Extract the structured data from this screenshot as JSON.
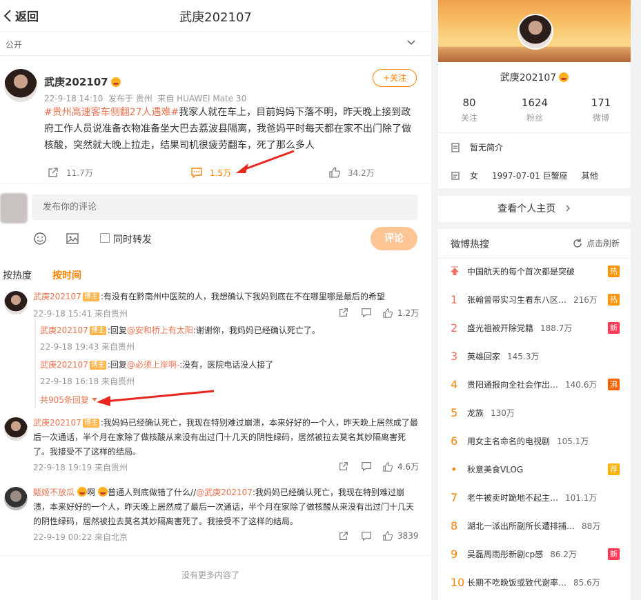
{
  "colors": {
    "brand": "#ff8200",
    "link": "#eb7350",
    "hot": "#ff9406",
    "new": "#ff3852",
    "boil": "#f86400",
    "recommend": "#ffb000"
  },
  "header": {
    "back_label": "返回",
    "title": "武庚202107",
    "visibility": "公开"
  },
  "post": {
    "author": "武庚202107",
    "follow_label": "+关注",
    "time": "22-9-18 14:10",
    "published_from": "发布于 贵州",
    "device": "来自 HUAWEI Mate 30",
    "hashtag": "#贵州高速客车侧翻27人遇难#",
    "text": "我家人就在车上，目前妈妈下落不明，昨天晚上接到政府工作人员说准备衣物准备坐大巴去荔波县隔离，我爸妈平时每天都在家不出门除了做核酸，突然就大晚上拉走，结果司机很疲劳翻车，死了那么多人",
    "reposts": "11.7万",
    "comments": "1.5万",
    "likes": "34.2万"
  },
  "composer": {
    "placeholder": "发布你的评论",
    "repost_label": "同时转发",
    "submit_label": "评论"
  },
  "sort": {
    "hot_label": "按热度",
    "time_label": "按时间"
  },
  "comments": [
    {
      "author": "武庚202107",
      "badge": "博主",
      "text": ":有没有在黔南州中医院的人，我想确认下我妈到底在不在哪里哪是最后的希望",
      "meta": "22-9-18 15:41 来自贵州",
      "likes": "1.2万",
      "replies": [
        {
          "author": "武庚202107",
          "badge": "博主",
          "prefix": ":回复",
          "mention": "@安和桥上有太阳",
          "text": ":谢谢你，我妈妈已经确认死亡了。",
          "meta": "22-9-18 19:43 来自贵州"
        },
        {
          "author": "武庚202107",
          "badge": "博主",
          "prefix": ":回复",
          "mention": "@必须上岸啊-",
          "text": ":没有，医院电话没人接了",
          "meta": "22-9-18 16:18 来自贵州"
        }
      ],
      "more_replies": "共905条回复"
    },
    {
      "author": "武庚202107",
      "badge": "博主",
      "text": ":我妈妈已经确认死亡，我现在特别难过崩溃，本来好好的一个人，昨天晚上居然成了最后一次通话，半个月在家除了做核酸从来没有出过门十几天的阴性绿码，居然被拉去莫名其妙隔离害死了。我接受不了这样的结局。",
      "meta": "22-9-18 19:19 来自贵州",
      "likes": "4.6万"
    },
    {
      "author": "甄姬不放瓜",
      "text_before": "啊",
      "text_mid": "普通人到底做错了什么//",
      "mention": "@武庚202107",
      "text": ":我妈妈已经确认死亡，我现在特别难过崩溃，本来好好的一个人，昨天晚上居然成了最后一次通话，半个月在家除了做核酸从来没有出过门十几天的阴性绿码，居然被拉去莫名其妙隔离害死了。我接受不了这样的结局。",
      "meta": "22-9-19 00:22 来自北京",
      "likes": "3839"
    }
  ],
  "no_more": "没有更多内容了",
  "profile": {
    "name": "武庚202107",
    "stats": [
      {
        "num": "80",
        "label": "关注"
      },
      {
        "num": "1624",
        "label": "粉丝"
      },
      {
        "num": "171",
        "label": "微博"
      }
    ],
    "bio": "暂无简介",
    "gender": "女",
    "birthday": "1997-07-01 巨蟹座",
    "other": "其他",
    "homepage_label": "查看个人主页"
  },
  "hot_search": {
    "title": "微博热搜",
    "refresh_label": "点击刷新",
    "items": [
      {
        "rank": "",
        "text": "中国航天的每个首次都是突破",
        "count": "",
        "badge": "热"
      },
      {
        "rank": "1",
        "text": "张翰曾带实习生看东八区…",
        "count": "216万",
        "badge": "热"
      },
      {
        "rank": "2",
        "text": "盛光祖被开除党籍",
        "count": "188.7万",
        "badge": "新"
      },
      {
        "rank": "3",
        "text": "英雄回家",
        "count": "145.3万",
        "badge": ""
      },
      {
        "rank": "4",
        "text": "贵阳通报向全社会作出…",
        "count": "140.6万",
        "badge": "沸"
      },
      {
        "rank": "5",
        "text": "龙族",
        "count": "130万",
        "badge": ""
      },
      {
        "rank": "6",
        "text": "用女主名命名的电视剧",
        "count": "105.1万",
        "badge": ""
      },
      {
        "rank": "•",
        "text": "秋意美食VLOG",
        "count": "",
        "badge": "荐"
      },
      {
        "rank": "7",
        "text": "老牛被卖时跪地不起主…",
        "count": "101.1万",
        "badge": ""
      },
      {
        "rank": "8",
        "text": "湖北一派出所副所长遭排捕…",
        "count": "88万",
        "badge": ""
      },
      {
        "rank": "9",
        "text": "吴磊周雨彤新剧cp感",
        "count": "86.2万",
        "badge": "新"
      },
      {
        "rank": "10",
        "text": "长期不吃晚饭或致代谢率…",
        "count": "85.6万",
        "badge": ""
      }
    ]
  }
}
